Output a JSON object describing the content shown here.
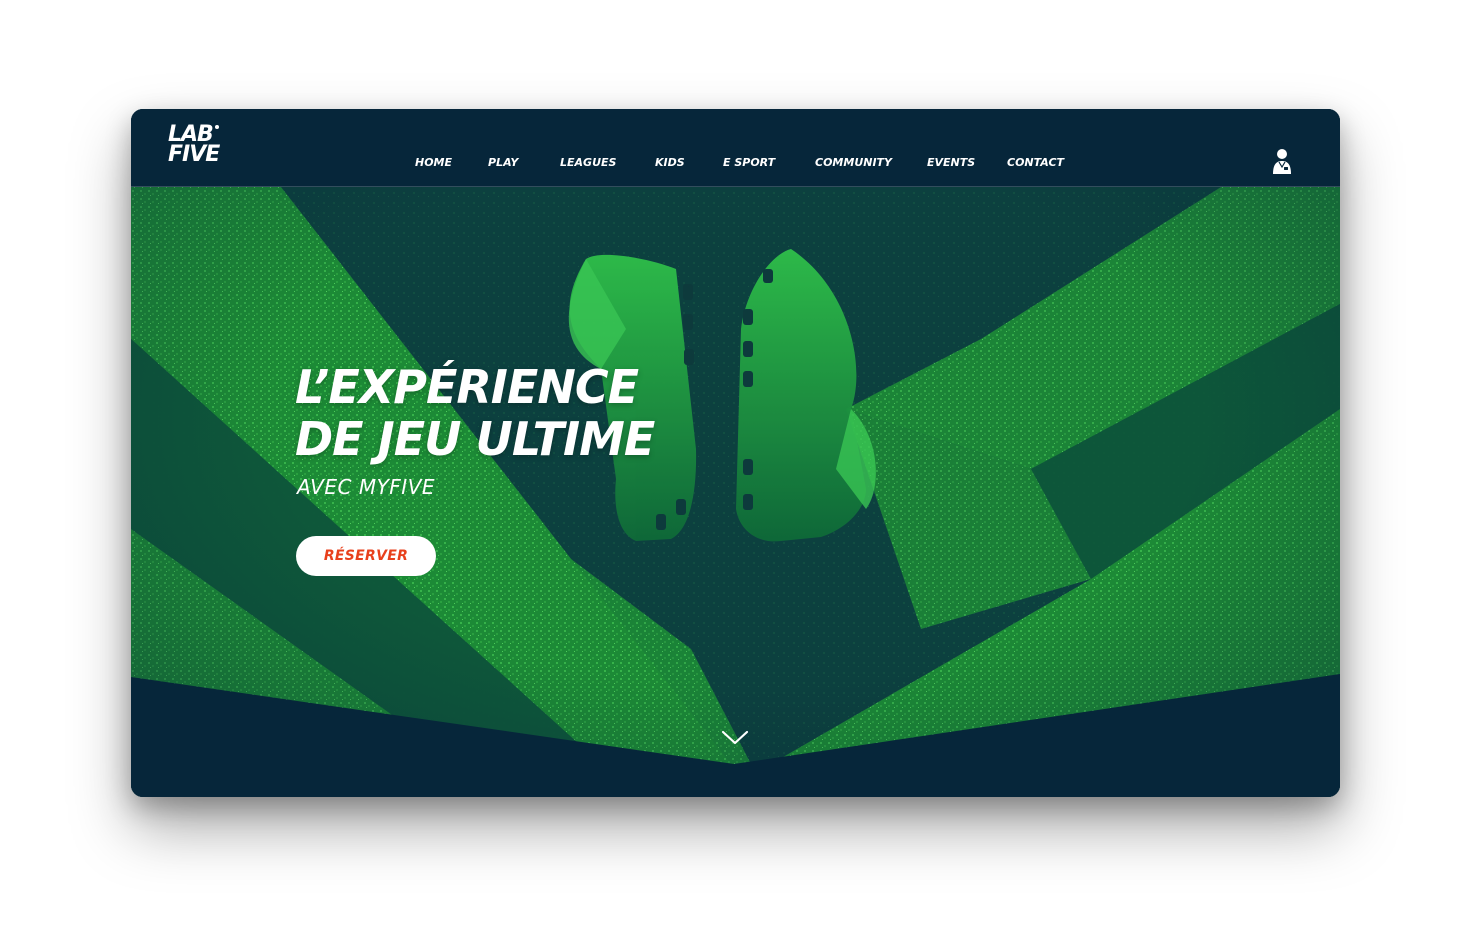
{
  "brand": {
    "logo_line1": "LAB",
    "logo_line2": "FIVE"
  },
  "nav": {
    "items": [
      {
        "label": "HOME"
      },
      {
        "label": "PLAY"
      },
      {
        "label": "LEAGUES"
      },
      {
        "label": "KIDS"
      },
      {
        "label": "E SPORT"
      },
      {
        "label": "COMMUNITY"
      },
      {
        "label": "EVENTS"
      },
      {
        "label": "CONTACT"
      }
    ]
  },
  "header": {
    "user_icon": "user-account-icon"
  },
  "hero": {
    "headline_line1": "L’EXPÉRIENCE",
    "headline_line2": "DE JEU ULTIME",
    "subline": "AVEC MYFIVE",
    "cta_label": "RÉSERVER",
    "scroll_icon": "chevron-down-icon"
  },
  "colors": {
    "background_navy": "#06263a",
    "grass_green": "#1f8f3a",
    "grass_light": "#3fbf4f",
    "cta_text": "#e8401c",
    "text": "#ffffff"
  }
}
